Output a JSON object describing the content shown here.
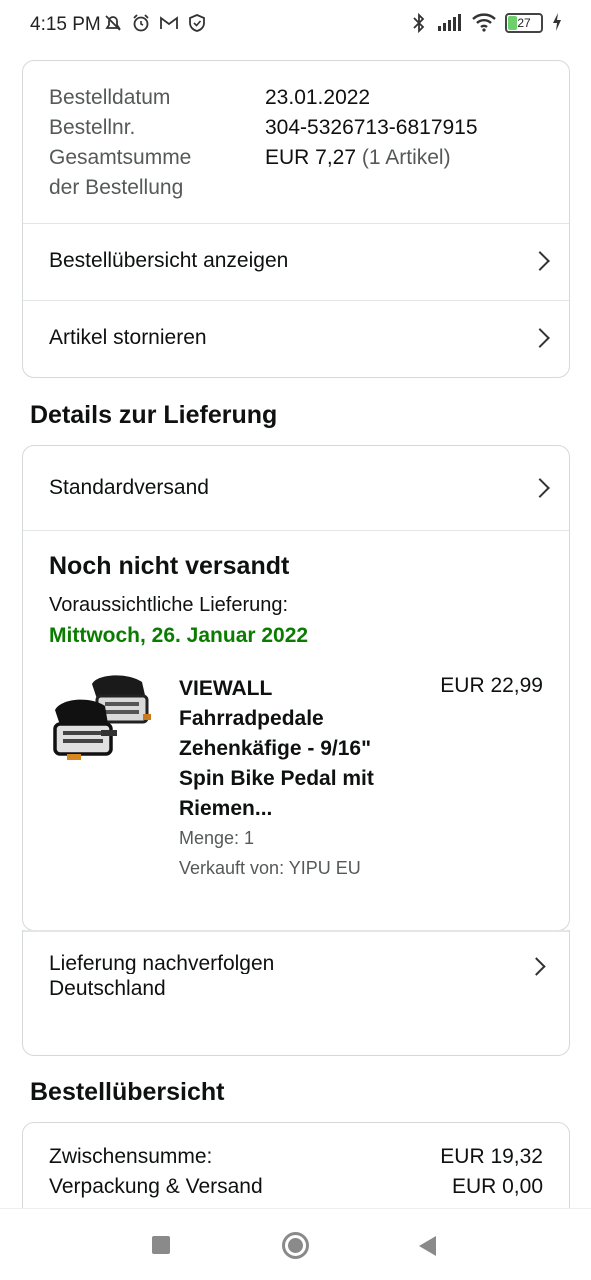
{
  "status_bar": {
    "time": "4:15 PM",
    "left_icons": [
      "mute-icon",
      "alarm-icon",
      "gmail-icon",
      "shield-icon"
    ],
    "right_icons": [
      "bluetooth-icon",
      "signal-icon",
      "wifi-icon"
    ],
    "battery_level": "27",
    "battery_fraction": 0.27
  },
  "order_info": {
    "rows": [
      {
        "label": "Bestelldatum",
        "value": "23.01.2022"
      },
      {
        "label": "Bestellnr.",
        "value": "304-5326713-6817915"
      },
      {
        "label": "Gesamtsumme",
        "label2": "der Bestellung",
        "value": "EUR 7,27",
        "value_note": "(1 Artikel)"
      }
    ],
    "link_overview": "Bestellübersicht anzeigen",
    "link_cancel": "Artikel stornieren"
  },
  "delivery": {
    "section_title": "Details zur Lieferung",
    "shipping_method": "Standardversand",
    "ship_status": "Noch nicht versandt",
    "estimate_label": "Voraussichtliche Lieferung:",
    "estimate_date": "Mittwoch, 26. Januar 2022",
    "estimate_color": "#0a7d00",
    "product": {
      "title_lines": [
        "VIEWALL",
        "Fahrradpedale",
        "Zehenkäfige - 9/16\"",
        "Spin Bike Pedal mit",
        "Riemen..."
      ],
      "price": "EUR 22,99",
      "quantity": "Menge: 1",
      "seller": "Verkauft von: YIPU EU"
    },
    "track_link": "Lieferung nachverfolgen",
    "overlap_text": "Deutschland"
  },
  "summary": {
    "section_title": "Bestellübersicht",
    "rows": [
      {
        "label": "Zwischensumme:",
        "value": "EUR 19,32"
      },
      {
        "label": "Verpackung & Versand",
        "value": "EUR 0,00"
      }
    ]
  },
  "nav": {
    "icons": [
      "recents-square-icon",
      "home-circle-icon",
      "back-triangle-icon"
    ]
  }
}
